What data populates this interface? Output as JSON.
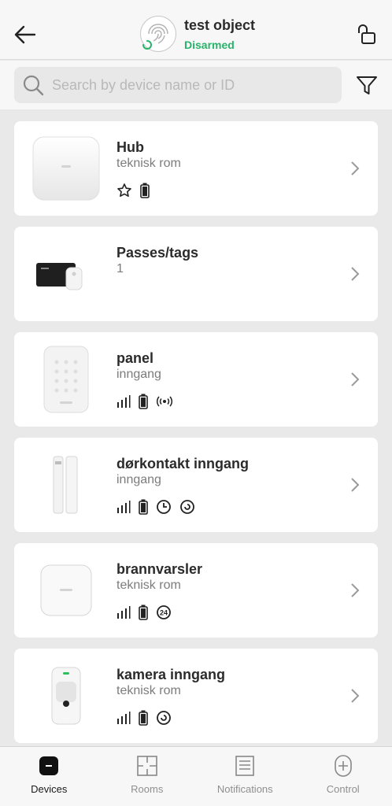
{
  "header": {
    "title": "test object",
    "status": "Disarmed",
    "status_color": "#27b36a",
    "back_icon": "arrow-left-icon",
    "lock_icon": "unlock-icon"
  },
  "search": {
    "placeholder": "Search by device name or ID",
    "value": ""
  },
  "devices": [
    {
      "name": "Hub",
      "room": "teknisk rom",
      "icons": [
        "star-icon",
        "battery-icon"
      ],
      "thumb": "hub"
    },
    {
      "name": "Passes/tags",
      "room": "1",
      "icons": [],
      "thumb": "passes"
    },
    {
      "name": "panel",
      "room": "inngang",
      "icons": [
        "signal-icon",
        "battery-icon",
        "radio-icon"
      ],
      "thumb": "keypad"
    },
    {
      "name": "dørkontakt inngang",
      "room": "inngang",
      "icons": [
        "signal-icon",
        "battery-icon",
        "clock-icon",
        "spiral-icon"
      ],
      "thumb": "doorprotect"
    },
    {
      "name": "brannvarsler",
      "room": "teknisk rom",
      "icons": [
        "signal-icon",
        "battery-icon",
        "24-icon"
      ],
      "thumb": "fireprotect"
    },
    {
      "name": "kamera inngang",
      "room": "teknisk rom",
      "icons": [
        "signal-icon",
        "battery-icon",
        "spiral-icon"
      ],
      "thumb": "motioncam"
    }
  ],
  "nav": [
    {
      "label": "Devices",
      "icon": "devices-icon",
      "active": true
    },
    {
      "label": "Rooms",
      "icon": "rooms-icon",
      "active": false
    },
    {
      "label": "Notifications",
      "icon": "notifications-icon",
      "active": false
    },
    {
      "label": "Control",
      "icon": "control-icon",
      "active": false
    }
  ]
}
